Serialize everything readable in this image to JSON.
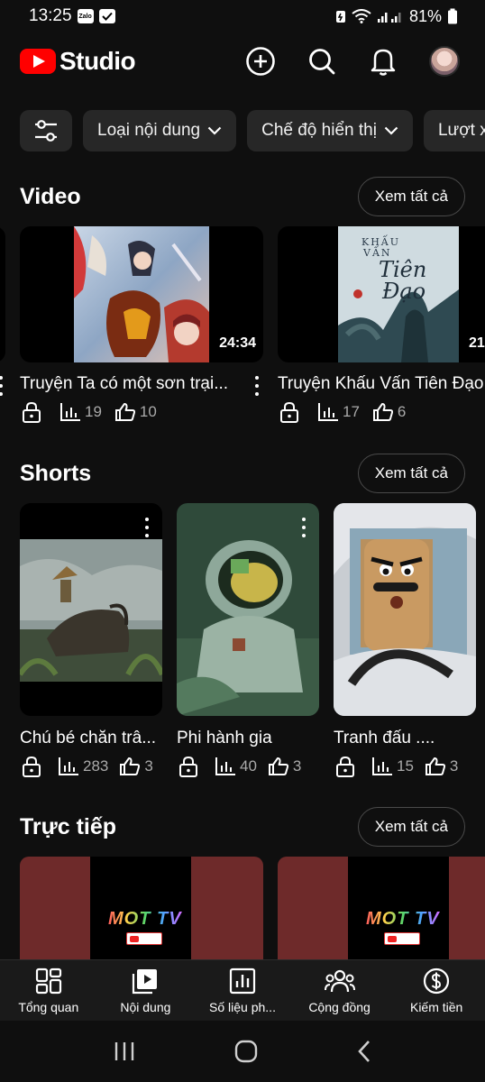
{
  "status_bar": {
    "time": "13:25",
    "app_badge": "Zalo",
    "battery": "81%"
  },
  "app": {
    "logo_text": "Studio"
  },
  "filters": {
    "chips": [
      "Loại nội dung",
      "Chế độ hiển thị",
      "Lượt x"
    ]
  },
  "video_section": {
    "title": "Video",
    "see_all": "Xem tất cả",
    "items": [
      {
        "title": "Truyện Ta có một sơn trại...",
        "duration": "24:34",
        "views": "19",
        "likes": "10"
      },
      {
        "title": "Truyện Khấu Vấn Tiên Đạo",
        "duration": "21",
        "views": "17",
        "likes": "6",
        "thumb_text": [
          "KHẤU",
          "VẤN",
          "Tiên",
          "Đạo"
        ]
      }
    ]
  },
  "shorts_section": {
    "title": "Shorts",
    "see_all": "Xem tất cả",
    "items": [
      {
        "title": "Chú bé chăn trâ...",
        "views": "283",
        "likes": "3"
      },
      {
        "title": "Phi hành gia",
        "views": "40",
        "likes": "3"
      },
      {
        "title": "Tranh đấu ....",
        "views": "15",
        "likes": "3"
      }
    ]
  },
  "live_section": {
    "title": "Trực tiếp",
    "see_all": "Xem tất cả",
    "items": [
      {
        "logo_text": "MOT TV"
      },
      {
        "logo_text": "MOT TV"
      }
    ]
  },
  "bottom_nav": [
    {
      "label": "Tổng quan",
      "icon": "dashboard-icon"
    },
    {
      "label": "Nội dung",
      "icon": "content-icon"
    },
    {
      "label": "Số liệu ph...",
      "icon": "analytics-icon"
    },
    {
      "label": "Cộng đồng",
      "icon": "community-icon"
    },
    {
      "label": "Kiếm tiền",
      "icon": "earn-icon"
    }
  ],
  "colors": {
    "background": "#0f0f0f",
    "chip": "#272727",
    "brand_red": "#ff0000",
    "muted_text": "#aaaaaa"
  }
}
